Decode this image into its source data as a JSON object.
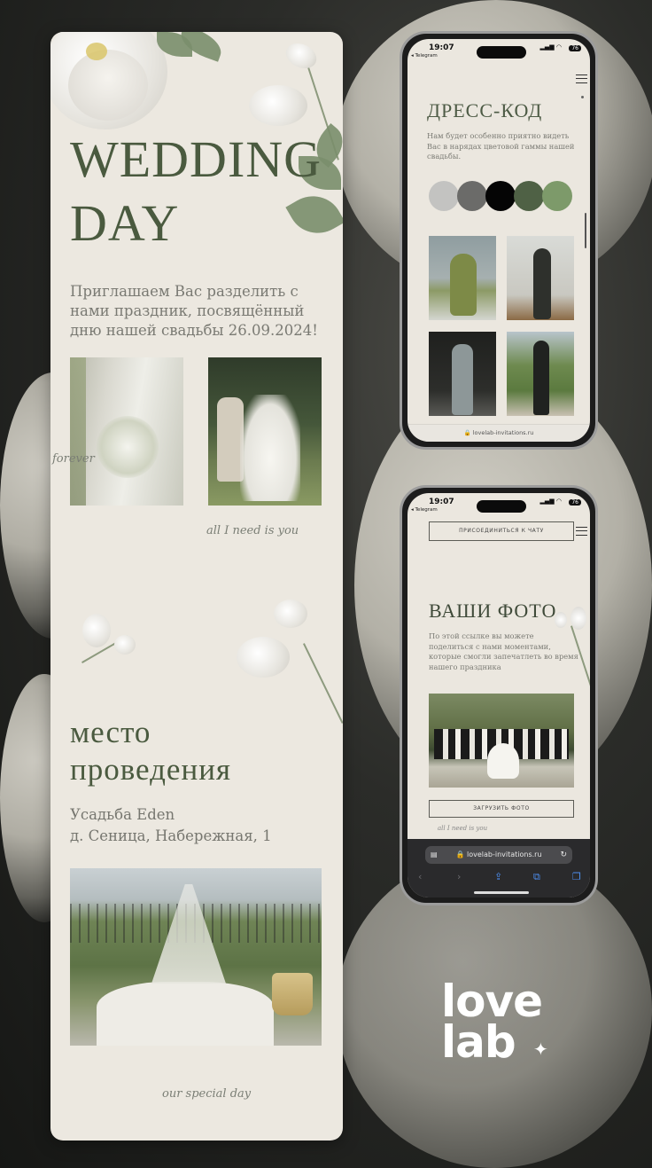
{
  "invitation_card": {
    "title_line1": "WEDDING",
    "title_line2": "DAY",
    "invitation_text": "Приглашаем Вас разделить с нами праздник, посвящённый дню нашей свадьбы 26.09.2024!",
    "script_forever": "forever",
    "script_all_i_need": "all I need is you",
    "venue_title_line1": "место",
    "venue_title_line2": "проведения",
    "venue_name": "Усадьба Eden",
    "venue_address": "д. Сеница, Набережная, 1",
    "script_footer": "our special day"
  },
  "phone_dresscode": {
    "time": "19:07",
    "telegram_label": "◂ Telegram",
    "battery": "76",
    "title": "ДРЕСС-КОД",
    "text": "Нам будет особенно приятно видеть Вас в нарядах цветовой гаммы нашей свадьбы.",
    "swatches": [
      "#c3c3c1",
      "#6b6b69",
      "#050505",
      "#4f6145",
      "#7d9a6a"
    ],
    "url": "lovelab-invitations.ru"
  },
  "phone_photos": {
    "time": "19:07",
    "telegram_label": "◂ Telegram",
    "battery": "76",
    "join_chat_button": "ПРИСОЕДИНИТЬСЯ К ЧАТУ",
    "title": "ВАШИ ФОТО",
    "text": "По этой ссылке вы можете поделиться с нами моментами, которые смогли запечатлеть во время нашего праздника",
    "upload_button": "ЗАГРУЗИТЬ ФОТО",
    "script_text": "all I need is you",
    "url": "lovelab-invitations.ru"
  },
  "brand": {
    "logo_line1": "love",
    "logo_line2": "lab"
  },
  "colors": {
    "accent_green": "#4a5a3f",
    "paper": "#ece8e0",
    "background_dark": "#1f201e"
  }
}
